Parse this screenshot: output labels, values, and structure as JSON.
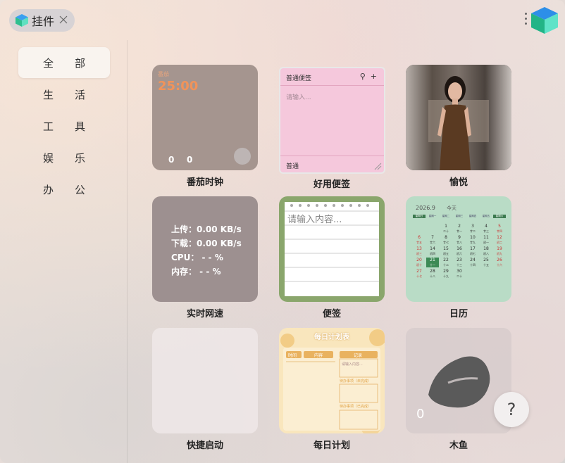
{
  "window": {
    "title": "挂件"
  },
  "sidebar": {
    "items": [
      {
        "label": "全部",
        "active": true
      },
      {
        "label": "生活",
        "active": false
      },
      {
        "label": "工具",
        "active": false
      },
      {
        "label": "娱乐",
        "active": false
      },
      {
        "label": "办公",
        "active": false
      }
    ]
  },
  "widgets": {
    "pomodoro": {
      "name": "番茄时钟",
      "small": "番茄",
      "time": "25:00",
      "count_a": "0",
      "count_b": "0"
    },
    "sticky": {
      "name": "好用便签",
      "header": "普通便签",
      "placeholder": "请输入...",
      "footer": "普通"
    },
    "photo": {
      "name": "愉悦"
    },
    "netspeed": {
      "name": "实时网速",
      "upload": "上传：0.00 KB/s",
      "download": "下载：0.00 KB/s",
      "cpu": "CPU： - - %",
      "mem": "内存： - - %"
    },
    "notes": {
      "name": "便签",
      "placeholder": "请输入内容..."
    },
    "calendar": {
      "name": "日历",
      "month": "2026.9",
      "today": "今天",
      "weekdays": [
        "星期日",
        "星期一",
        "星期二",
        "星期三",
        "星期四",
        "星期五",
        "星期六"
      ],
      "rows": [
        [
          "",
          "",
          "1",
          "2",
          "3",
          "4",
          "5"
        ],
        [
          "6",
          "7",
          "8",
          "9",
          "10",
          "11",
          "12"
        ],
        [
          "13",
          "14",
          "15",
          "16",
          "17",
          "18",
          "19"
        ],
        [
          "20",
          "21",
          "22",
          "23",
          "24",
          "25",
          "26"
        ],
        [
          "27",
          "28",
          "29",
          "30",
          "",
          "",
          ""
        ]
      ],
      "lunar": [
        [
          "",
          "",
          "二十",
          "廿一",
          "廿二",
          "廿三",
          "廿四"
        ],
        [
          "廿五",
          "廿六",
          "廿七",
          "廿八",
          "廿九",
          "初一",
          "初二"
        ],
        [
          "初三",
          "初四",
          "初五",
          "初六",
          "初七",
          "初八",
          "初九"
        ],
        [
          "初十",
          "十一",
          "十二",
          "十三",
          "十四",
          "十五",
          "十六"
        ],
        [
          "十七",
          "十八",
          "十九",
          "二十",
          "",
          "",
          ""
        ]
      ],
      "selected_day": "21"
    },
    "quicklaunch": {
      "name": "快捷启动"
    },
    "dailyplan": {
      "name": "每日计划",
      "header": "每日计划表",
      "col_time": "时间",
      "col_content": "内容",
      "col_note": "记录",
      "ph": "请输入内容...",
      "todo": "待办事项（未完成）",
      "done": "待办事项（已完成）"
    },
    "woodfish": {
      "name": "木鱼",
      "count": "0"
    }
  },
  "help": {
    "label": "?"
  }
}
